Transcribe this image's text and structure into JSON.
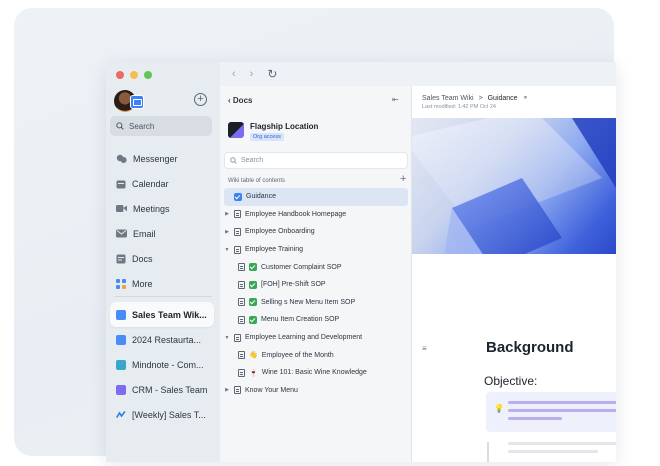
{
  "rail": {
    "search_label": "Search",
    "nav": [
      {
        "label": "Messenger",
        "icon": "messenger-icon"
      },
      {
        "label": "Calendar",
        "icon": "calendar-icon"
      },
      {
        "label": "Meetings",
        "icon": "video-camera-icon"
      },
      {
        "label": "Email",
        "icon": "mail-icon"
      },
      {
        "label": "Docs",
        "icon": "docs-icon"
      },
      {
        "label": "More",
        "icon": "grid-icon"
      }
    ],
    "docs": [
      {
        "label": "Sales Team Wik...",
        "color": "#4a8cf7"
      },
      {
        "label": "2024 Restaurta...",
        "color": "#4a8cf7"
      },
      {
        "label": "Mindnote - Com...",
        "color": "#3aa6c9"
      },
      {
        "label": "CRM - Sales Team",
        "color": "#7c6cf0"
      },
      {
        "label": "[Weekly] Sales T...",
        "color": "#2f7ae5"
      }
    ]
  },
  "docs_panel": {
    "back_label": "Docs",
    "space_name": "Flagship Location",
    "space_badge": "Org access",
    "search_placeholder": "Search",
    "toc_label": "Wiki table of contents",
    "tree": [
      {
        "label": "Guidance",
        "indent": 1,
        "caret": false,
        "icon": "check-blue"
      },
      {
        "label": "Employee Handbook Homepage",
        "indent": 0,
        "caret": "right",
        "icon": "page"
      },
      {
        "label": "Employee Onboarding",
        "indent": 0,
        "caret": "right",
        "icon": "page"
      },
      {
        "label": "Employee Training",
        "indent": 0,
        "caret": "down",
        "icon": "page"
      },
      {
        "label": "Customer Complaint SOP",
        "indent": 1,
        "caret": false,
        "icon": "page-check"
      },
      {
        "label": "[FOH] Pre-Shift SOP",
        "indent": 1,
        "caret": false,
        "icon": "page-check"
      },
      {
        "label": "Selling s New Menu Item SOP",
        "indent": 1,
        "caret": false,
        "icon": "page-check"
      },
      {
        "label": "Menu Item Creation SOP",
        "indent": 1,
        "caret": false,
        "icon": "page-check"
      },
      {
        "label": "Employee Learning and Development",
        "indent": 0,
        "caret": "down",
        "icon": "page"
      },
      {
        "label": "Employee of the Month",
        "indent": 1,
        "caret": false,
        "icon": "page-hand"
      },
      {
        "label": "Wine 101: Basic Wine Knowledge",
        "indent": 1,
        "caret": false,
        "icon": "page-wine"
      },
      {
        "label": "Know Your Menu",
        "indent": 0,
        "caret": "right",
        "icon": "page"
      }
    ]
  },
  "content": {
    "breadcrumb_root": "Sales Team Wiki",
    "breadcrumb_sep": ">",
    "breadcrumb_current": "Guidance",
    "last_modified": "Last modified: 1:42 PM Oct 24",
    "heading": "Background",
    "subheading": "Objective:"
  }
}
